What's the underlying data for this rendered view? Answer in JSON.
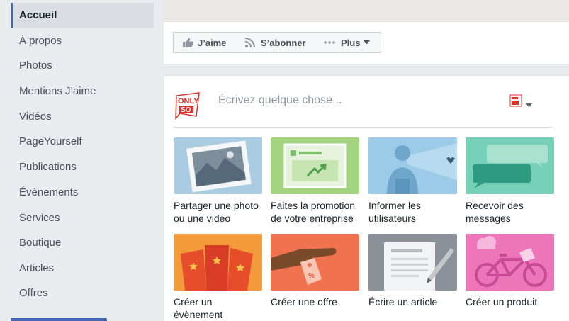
{
  "sidebar": {
    "items": [
      {
        "label": "Accueil",
        "active": true
      },
      {
        "label": "À propos"
      },
      {
        "label": "Photos"
      },
      {
        "label": "Mentions J’aime"
      },
      {
        "label": "Vidéos"
      },
      {
        "label": "PageYourself"
      },
      {
        "label": "Publications"
      },
      {
        "label": "Évènements"
      },
      {
        "label": "Services"
      },
      {
        "label": "Boutique"
      },
      {
        "label": "Articles"
      },
      {
        "label": "Offres"
      }
    ]
  },
  "actions": {
    "like_label": "J’aime",
    "follow_label": "S’abonner",
    "more_label": "Plus"
  },
  "composer": {
    "placeholder": "Écrivez quelque chose...",
    "logo_text_top": "ONLY",
    "logo_text_bottom": "SO"
  },
  "tiles": [
    {
      "caption": "Partager une photo ou une vidéo",
      "icon": "photo-icon",
      "color": "#a9cce3"
    },
    {
      "caption": "Faites la promotion de votre entreprise",
      "icon": "promotion-icon",
      "color": "#a3d37e"
    },
    {
      "caption": "Informer les utilisateurs",
      "icon": "inform-icon",
      "color": "#9bcbe6"
    },
    {
      "caption": "Recevoir des messages",
      "icon": "messages-icon",
      "color": "#76cfb7"
    },
    {
      "caption": "Créer un évènement",
      "icon": "event-icon",
      "color": "#f39a3a"
    },
    {
      "caption": "Créer une offre",
      "icon": "offer-icon",
      "color": "#f0724f"
    },
    {
      "caption": "Écrire un article",
      "icon": "article-icon",
      "color": "#8c9199"
    },
    {
      "caption": "Créer un produit",
      "icon": "product-icon",
      "color": "#ee75ba"
    }
  ],
  "colors": {
    "accent": "#4267b2",
    "page_bg": "#e9ebee",
    "logo_red": "#e0322b"
  }
}
